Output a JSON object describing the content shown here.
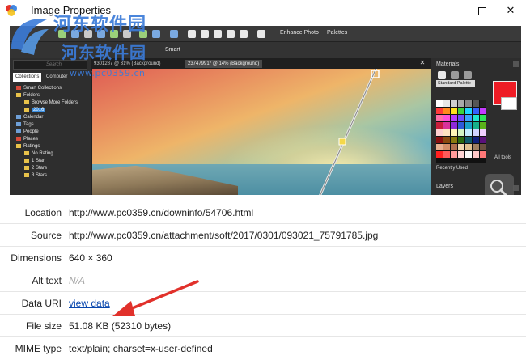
{
  "window": {
    "title": "Image Properties",
    "minimize_glyph": "—",
    "close_glyph": "✕"
  },
  "watermark": {
    "line1": "河东软件园",
    "line2": "河东软件园",
    "url": "www.pc0359.cn"
  },
  "preview": {
    "toolbar": {
      "enhance_label": "Enhance Photo",
      "palettes_label": "Palettes"
    },
    "toolbar2_text": "Smart",
    "search_placeholder": "Search",
    "tabs": [
      "Collections",
      "Computer"
    ],
    "tree": [
      "Smart Collections",
      "Folders",
      "Browse More Folders",
      "2016",
      "Calendar",
      "Tags",
      "People",
      "Places",
      "Ratings",
      "No Rating",
      "1 Star",
      "2 Stars",
      "3 Stars"
    ],
    "doc_tabs": [
      "9301287 @ 31% (Background)",
      "23747991* @ 14% (Background)"
    ],
    "materials_title": "Materials",
    "standard_palette": "Standard Palette",
    "recently_used": "Recently Used",
    "all_tools": "All tools",
    "layers_title": "Layers"
  },
  "properties": [
    {
      "label": "Location",
      "value": "http://www.pc0359.cn/downinfo/54706.html"
    },
    {
      "label": "Source",
      "value": "http://www.pc0359.cn/attachment/soft/2017/0301/093021_75791785.jpg"
    },
    {
      "label": "Dimensions",
      "value": "640 × 360"
    },
    {
      "label": "Alt text",
      "value": "N/A"
    },
    {
      "label": "Data URI",
      "value": "view data"
    },
    {
      "label": "File size",
      "value": "51.08 KB (52310 bytes)"
    },
    {
      "label": "MIME type",
      "value": "text/plain; charset=x-user-defined"
    }
  ],
  "colors": {
    "link": "#0645ad",
    "arrow": "#e1312b",
    "swatch_fg": "#ee1c25"
  }
}
